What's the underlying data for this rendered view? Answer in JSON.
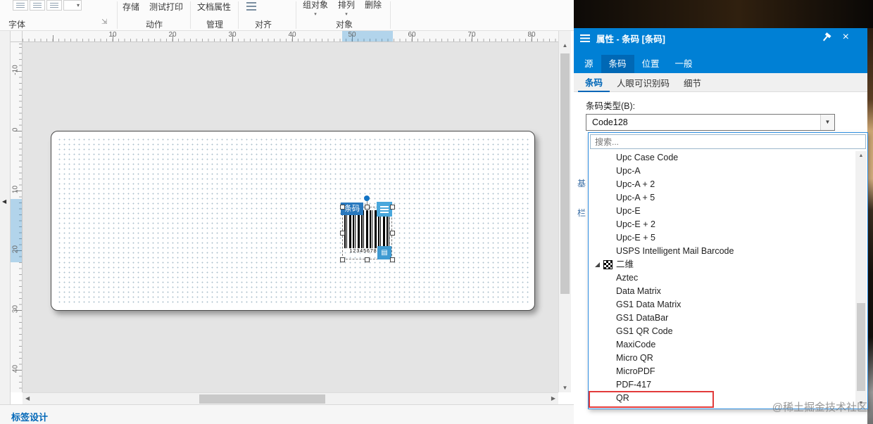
{
  "toolbar": {
    "font_group_label": "字体",
    "action_buttons": [
      "存储",
      "测试打印"
    ],
    "action_group_label": "动作",
    "manage_buttons": [
      "文档属性"
    ],
    "manage_group_label": "管理",
    "align_group_label": "对齐",
    "object_buttons": [
      "组对象",
      "排列",
      "删除"
    ],
    "object_group_label": "对象"
  },
  "rulers": {
    "horizontal_numbers": [
      "10",
      "20",
      "30",
      "40",
      "50",
      "60",
      "70",
      "80"
    ],
    "vertical_numbers": [
      "-10",
      "0",
      "10",
      "20",
      "30",
      "40"
    ]
  },
  "canvas": {
    "selected_object_tag": "条码",
    "barcode_caption": "1234567890"
  },
  "bottom_bar": {
    "design_tab_label": "标签设计"
  },
  "properties_panel": {
    "title": "属性 - 条码 [条码]",
    "tabs": [
      "源",
      "条码",
      "位置",
      "一般"
    ],
    "active_tab": "条码",
    "sub_tabs": [
      "条码",
      "人眼可识别码",
      "细节"
    ],
    "active_sub_tab": "条码",
    "barcode_type_label": "条码类型(B):",
    "barcode_type_value": "Code128",
    "search_placeholder": "搜索...",
    "side_tab_fragments": [
      "基",
      "栏"
    ],
    "type_list": [
      {
        "label": "Upc Case Code",
        "kind": "item"
      },
      {
        "label": "Upc-A",
        "kind": "item"
      },
      {
        "label": "Upc-A + 2",
        "kind": "item"
      },
      {
        "label": "Upc-A + 5",
        "kind": "item"
      },
      {
        "label": "Upc-E",
        "kind": "item"
      },
      {
        "label": "Upc-E + 2",
        "kind": "item"
      },
      {
        "label": "Upc-E + 5",
        "kind": "item"
      },
      {
        "label": "USPS Intelligent Mail Barcode",
        "kind": "item"
      },
      {
        "label": "二维",
        "kind": "group"
      },
      {
        "label": "Aztec",
        "kind": "item"
      },
      {
        "label": "Data Matrix",
        "kind": "item"
      },
      {
        "label": "GS1 Data Matrix",
        "kind": "item"
      },
      {
        "label": "GS1 DataBar",
        "kind": "item"
      },
      {
        "label": "GS1 QR Code",
        "kind": "item"
      },
      {
        "label": "MaxiCode",
        "kind": "item"
      },
      {
        "label": "Micro QR",
        "kind": "item"
      },
      {
        "label": "MicroPDF",
        "kind": "item"
      },
      {
        "label": "PDF-417",
        "kind": "item"
      },
      {
        "label": "QR",
        "kind": "item",
        "highlighted": true
      }
    ]
  },
  "watermark": "@稀土掘金技术社区",
  "colors": {
    "panel_header_blue": "#0080d5",
    "accent_blue": "#0067b8",
    "selection_blue": "#2878be",
    "highlight_red": "#e23b3b",
    "canvas_gray": "#e4e4e4"
  }
}
